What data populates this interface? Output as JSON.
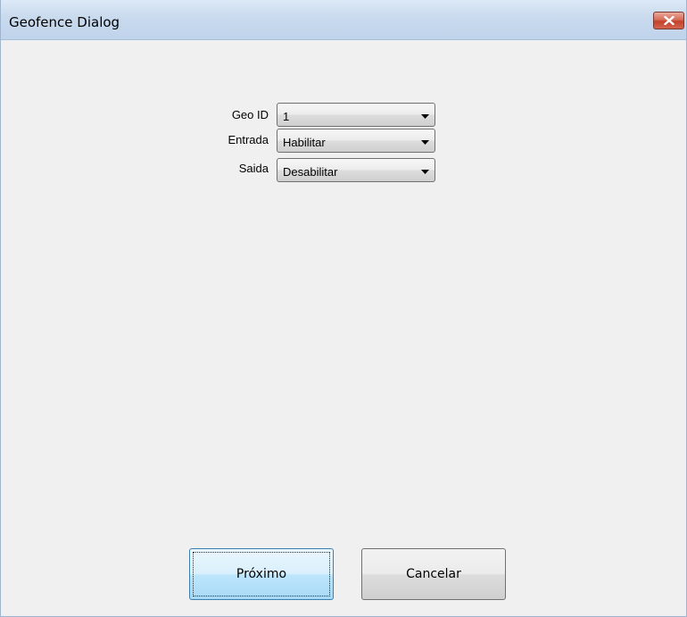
{
  "window": {
    "title": "Geofence Dialog"
  },
  "form": {
    "fields": [
      {
        "label": "Geo ID",
        "value": "1"
      },
      {
        "label": "Entrada",
        "value": "Habilitar"
      },
      {
        "label": "Saida",
        "value": "Desabilitar"
      }
    ]
  },
  "buttons": {
    "next_label": "Próximo",
    "cancel_label": "Cancelar"
  },
  "icons": {
    "close": "close-icon",
    "dropdown": "chevron-down-icon"
  },
  "colors": {
    "titlebar": "#c9daee",
    "close_button": "#c4412a",
    "background": "#f0f0f0",
    "default_button": "#bee6fd"
  }
}
